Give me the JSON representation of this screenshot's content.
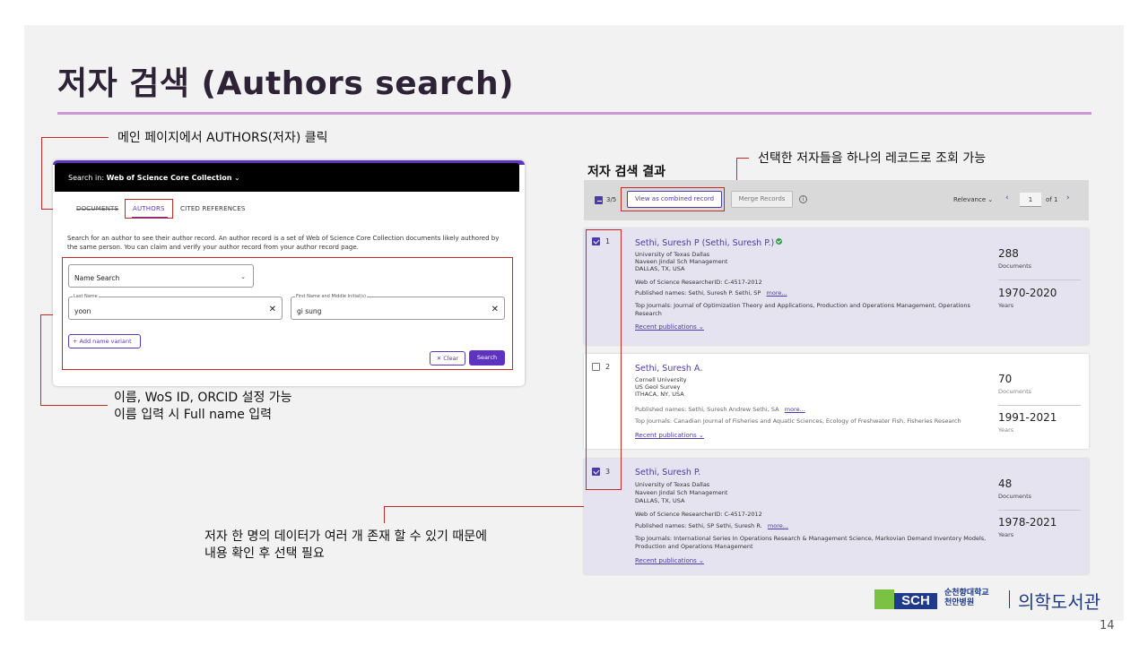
{
  "slide": {
    "title": "저자 검색 (Authors search)",
    "page_number": "14",
    "callout_top": "메인 페이지에서 AUTHORS(저자) 클릭",
    "callout_mid_1": "이름, WoS ID, ORCID 설정 가능",
    "callout_mid_2": "이름 입력 시 Full name 입력",
    "callout_bottom_1": "저자 한 명의 데이터가 여러 개 존재 할 수 있기 때문에",
    "callout_bottom_2": "내용 확인 후 선택 필요",
    "callout_right": "선택한 저자들을 하나의 레코드로 조회 가능",
    "results_title": "저자 검색 결과"
  },
  "search_panel": {
    "search_in_label": "Search in:",
    "search_in_value": "Web of Science Core Collection",
    "search_in_chevron": "⌄",
    "tabs": [
      "DOCUMENTS",
      "AUTHORS",
      "CITED REFERENCES"
    ],
    "description": "Search for an author to see their author record. An author record is a set of Web of Science Core Collection documents likely authored by the same person. You can claim and verify your author record from your author record page.",
    "search_type": "Name Search",
    "last_name_label": "Last Name",
    "last_name_value": "yoon",
    "first_name_label": "First Name and Middle Initial(s)",
    "first_name_value": "gi sung",
    "add_variant": "+ Add name variant",
    "clear_label": "✕ Clear",
    "search_label": "Search"
  },
  "results": {
    "selected_count": "3/5",
    "view_combined": "View as combined record",
    "merge": "Merge Records",
    "info_icon": "i",
    "sort": "Relevance ⌄",
    "page_current": "1",
    "page_of": "of 1",
    "prev_icon": "‹",
    "next_icon": "›",
    "items": [
      {
        "index": "1",
        "name": "Sethi, Suresh P (Sethi, Suresh P.)",
        "affil1": "University of Texas Dallas",
        "affil2": "Naveen Jindal Sch Management",
        "affil3": "DALLAS, TX, USA",
        "rid": "Web of Science ResearcherID: C-4517-2012",
        "published": "Published names: Sethi, Suresh P.   Sethi, SP",
        "more": "more...",
        "journals": "Top Journals: Journal of Optimization Theory and Applications, Production and Operations Management, Operations",
        "journals2": "Research",
        "recent": "Recent publications ⌄",
        "docs": "288",
        "docs_label": "Documents",
        "years": "1970-2020",
        "years_label": "Years"
      },
      {
        "index": "2",
        "name": "Sethi, Suresh A.",
        "affil1": "Cornell University",
        "affil2": "US Geol Survey",
        "affil3": "ITHACA, NY, USA",
        "published": "Published names: Sethi, Suresh Andrew   Sethi, SA",
        "more": "more...",
        "journals": "Top Journals: Canadian Journal of Fisheries and Aquatic Sciences, Ecology of Freshwater Fish, Fisheries Research",
        "recent": "Recent publications ⌄",
        "docs": "70",
        "docs_label": "Documents",
        "years": "1991-2021",
        "years_label": "Years"
      },
      {
        "index": "3",
        "name": "Sethi, Suresh P.",
        "affil1": "University of Texas Dallas",
        "affil2": "Naveen Jindal Sch Management",
        "affil3": "DALLAS, TX, USA",
        "rid": "Web of Science ResearcherID: C-4517-2012",
        "published": "Published names: Sethi, SP   Sethi, Suresh R.",
        "more": "more...",
        "journals": "Top Journals: International Series In Operations Research & Management Science, Markovian Demand Inventory Models,",
        "journals2": "Production and Operations Management",
        "recent": "Recent publications ⌄",
        "docs": "48",
        "docs_label": "Documents",
        "years": "1978-2021",
        "years_label": "Years"
      }
    ]
  },
  "footer": {
    "logo_mark": "SCH",
    "logo_kr_1": "순천향대학교",
    "logo_kr_2": "천안병원",
    "library": "의학도서관"
  },
  "colors": {
    "accent": "#5e33bf",
    "callout_red": "#c62828",
    "title_rule": "#c79bd1",
    "selected_card": "#e5e3ef"
  }
}
